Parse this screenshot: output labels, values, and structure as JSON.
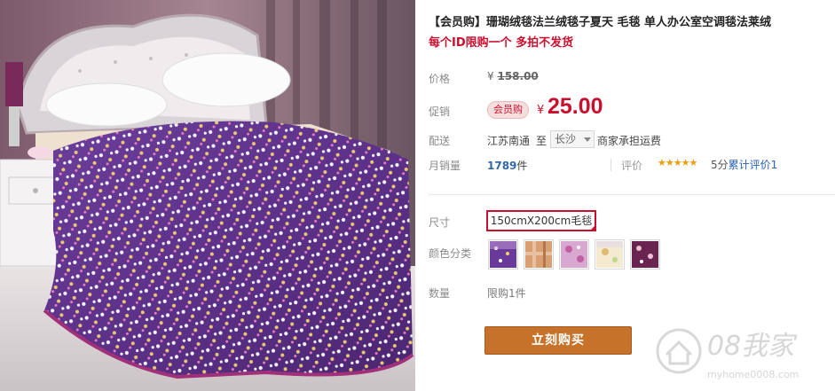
{
  "product": {
    "title": "【会员购】珊瑚绒毯法兰绒毯子夏天 毛毯 单人办公室空调毯法莱绒",
    "subtitle": "每个ID限购一个 多拍不发货"
  },
  "price": {
    "label": "价格",
    "currency": "¥",
    "original": "158.00"
  },
  "promo": {
    "label": "促销",
    "badge": "会员购",
    "currency": "¥",
    "sale_price": "25.00"
  },
  "shipping": {
    "label": "配送",
    "from": "江苏南通",
    "to_word": "至",
    "destination": "长沙",
    "note": "商家承担运费"
  },
  "sales": {
    "label": "月销量",
    "count": "1789",
    "unit": "件",
    "review_label": "评价",
    "stars_glyphs": "★★★★★",
    "stars_value": 5,
    "score_text": "5分",
    "review_link": "累计评价1"
  },
  "size": {
    "label": "尺寸",
    "selected": "150cmX200cm毛毯"
  },
  "color": {
    "label": "颜色分类",
    "swatches": [
      "purple-dot-swatch",
      "brown-plaid-swatch",
      "pink-floral-swatch",
      "cream-floral-swatch",
      "plum-print-swatch"
    ]
  },
  "quantity": {
    "label": "数量",
    "limit": "限购1件"
  },
  "buy_button": {
    "label": "立刻购买"
  },
  "watermark": {
    "text": "08我家",
    "url": "myhome0008.com"
  },
  "colors": {
    "accent": "#c8102e",
    "buy_button": "#c7722a",
    "link": "#2a62b6",
    "star": "#f09c10"
  }
}
